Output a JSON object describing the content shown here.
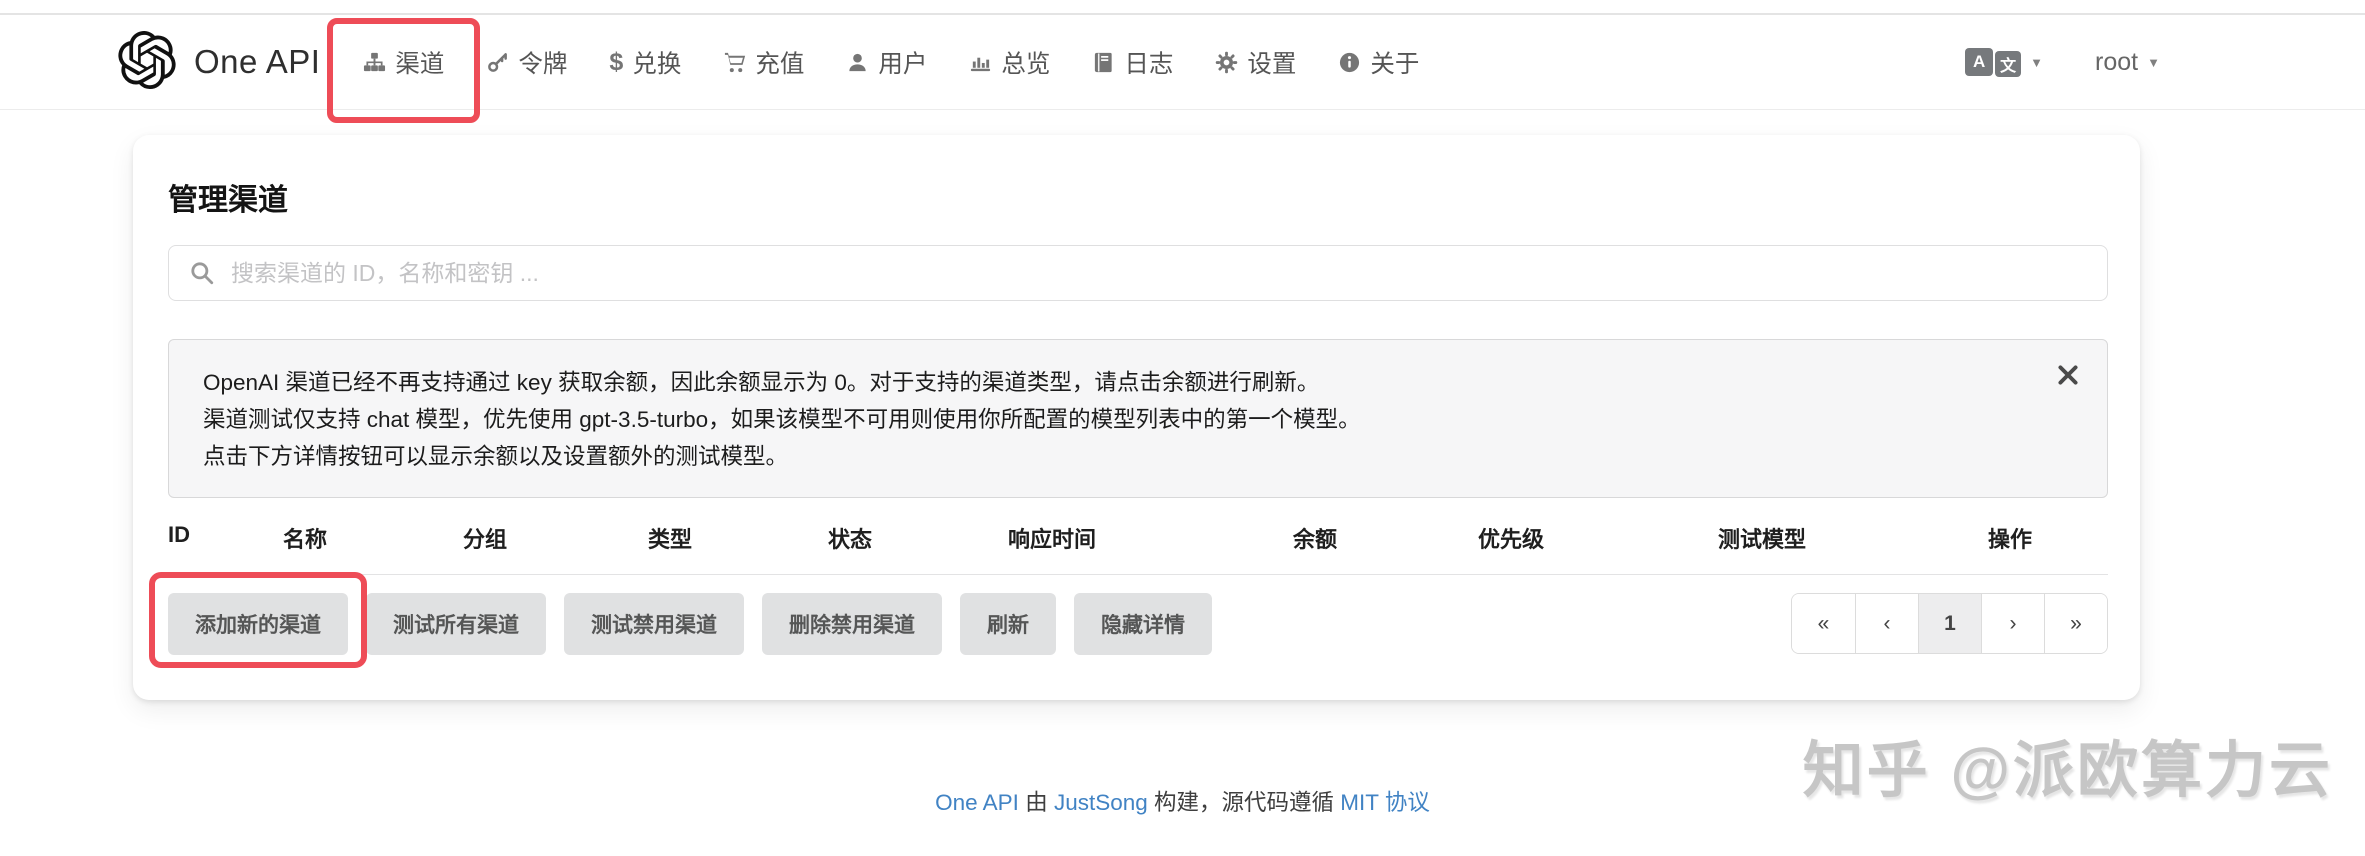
{
  "nav": {
    "brand": "One API",
    "items": [
      {
        "label": "渠道",
        "icon": "sitemap-icon",
        "highlighted": true
      },
      {
        "label": "令牌",
        "icon": "key-icon",
        "highlighted": false
      },
      {
        "label": "兑换",
        "icon": "dollar-icon",
        "highlighted": false
      },
      {
        "label": "充值",
        "icon": "cart-icon",
        "highlighted": false
      },
      {
        "label": "用户",
        "icon": "user-icon",
        "highlighted": false
      },
      {
        "label": "总览",
        "icon": "bar-chart-icon",
        "highlighted": false
      },
      {
        "label": "日志",
        "icon": "book-icon",
        "highlighted": false
      },
      {
        "label": "设置",
        "icon": "gear-icon",
        "highlighted": false
      },
      {
        "label": "关于",
        "icon": "info-icon",
        "highlighted": false
      }
    ],
    "language_selector": {
      "icon": "translate-icon",
      "letters": {
        "a": "A",
        "wen": "文"
      }
    },
    "user": "root",
    "caret": "▼"
  },
  "page": {
    "title": "管理渠道",
    "search": {
      "placeholder": "搜索渠道的 ID，名称和密钥 ..."
    },
    "notice": {
      "lines": [
        "OpenAI 渠道已经不再支持通过 key 获取余额，因此余额显示为 0。对于支持的渠道类型，请点击余额进行刷新。",
        "渠道测试仅支持 chat 模型，优先使用 gpt-3.5-turbo，如果该模型不可用则使用你所配置的模型列表中的第一个模型。",
        "点击下方详情按钮可以显示余额以及设置额外的测试模型。"
      ]
    },
    "table": {
      "headers": [
        "ID",
        "名称",
        "分组",
        "类型",
        "状态",
        "响应时间",
        "余额",
        "优先级",
        "测试模型",
        "操作"
      ]
    },
    "actions": [
      "添加新的渠道",
      "测试所有渠道",
      "测试禁用渠道",
      "删除禁用渠道",
      "刷新",
      "隐藏详情"
    ],
    "pagination": {
      "items": [
        "«",
        "‹",
        "1",
        "›",
        "»"
      ],
      "active": "1"
    }
  },
  "footer": {
    "brand_link": "One API",
    "text1": " 由 ",
    "author_link": "JustSong",
    "text2": " 构建，源代码遵循 ",
    "license_link": "MIT 协议"
  },
  "watermark": {
    "text": "知乎 @派欧算力云"
  },
  "colors": {
    "annotation_red": "#ee4c57",
    "link_blue": "#4183c4",
    "button_grey": "#e0e1e2",
    "icon_grey": "#757575"
  }
}
